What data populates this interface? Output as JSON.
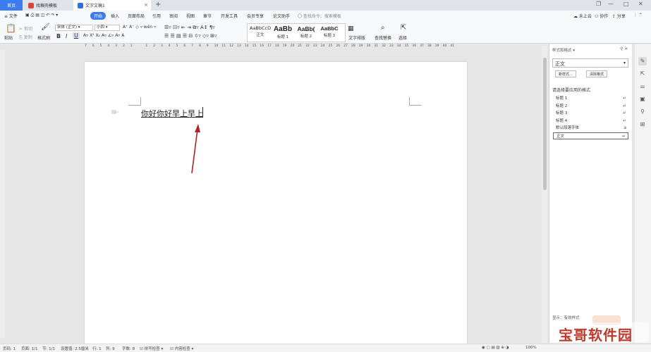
{
  "tabs": {
    "home": "首页",
    "doc1": "找稿壳模板",
    "doc2": "文字文稿1",
    "doc2_close": "×",
    "add": "+"
  },
  "window": {
    "restore": "❐",
    "min": "—",
    "max": "□",
    "close": "✕"
  },
  "menu": {
    "file": "≡ 文件",
    "items": [
      "开始",
      "插入",
      "页面布局",
      "引用",
      "审阅",
      "视图",
      "章节",
      "开发工具",
      "会员专享",
      "论文助手"
    ],
    "search": "〇 查找命令、搜索模板",
    "cloud": "☁ 未上云",
    "collab": "⚇ 协作",
    "share": "⇪ 分享"
  },
  "ribbon": {
    "paste": "粘贴",
    "cut": "剪切",
    "copy": "复制",
    "format_painter": "格式刷",
    "font_name": "宋体 (正文)",
    "font_size": "小四",
    "bold": "B",
    "italic": "I",
    "underline": "U",
    "text_layout": "文字排版",
    "find_replace": "查找替换",
    "select": "选择"
  },
  "styles": [
    {
      "sample": "AaBbCcD",
      "label": "正文"
    },
    {
      "sample": "AaBb",
      "label": "标题 1"
    },
    {
      "sample": "AaBb(",
      "label": "标题 2"
    },
    {
      "sample": "AaBbC",
      "label": "标题 3"
    }
  ],
  "ruler": [
    "7",
    "6",
    "5",
    "4",
    "3",
    "2",
    "1",
    "",
    "1",
    "2",
    "3",
    "4",
    "5",
    "6",
    "7",
    "8",
    "9",
    "10",
    "11",
    "12",
    "13",
    "14",
    "15",
    "16",
    "17",
    "18",
    "19",
    "20",
    "21",
    "22",
    "23",
    "24",
    "25",
    "26",
    "27",
    "28",
    "29",
    "30",
    "31",
    "32",
    "33",
    "34",
    "35",
    "36",
    "37",
    "38",
    "39",
    "40",
    "41"
  ],
  "document": {
    "text": "你好你好早上早上"
  },
  "panel": {
    "title": "样式和格式 ▾",
    "current": "正文",
    "new_style": "新样式...",
    "clear_format": "清除格式",
    "label": "请选择要应用的格式",
    "items": [
      {
        "name": "标题 1",
        "mark": "↵"
      },
      {
        "name": "标题 2",
        "mark": "↵"
      },
      {
        "name": "标题 3",
        "mark": "↵"
      },
      {
        "name": "标题 4",
        "mark": "↵"
      },
      {
        "name": "默认段落字体",
        "mark": "a"
      },
      {
        "name": "正文",
        "mark": "↵"
      }
    ],
    "bottom": "显示：有效样式"
  },
  "status": {
    "page": "页码: 1",
    "pages": "页面: 1/1",
    "section": "节: 1/1",
    "settings": "设置值: 2.5厘米",
    "row": "行: 1",
    "col": "列: 9",
    "words": "字数: 8",
    "spell": "拼写检查",
    "content": "内容检查",
    "zoom": "100%"
  },
  "watermark": "宝哥软件园",
  "colors": {
    "accent": "#3c7bf0",
    "arrow": "#b22222"
  }
}
